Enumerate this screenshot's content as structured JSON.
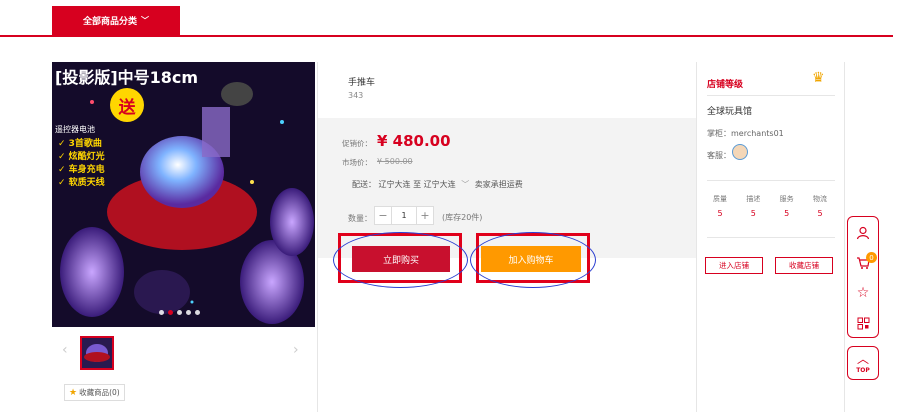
{
  "header": {
    "category_button": "全部商品分类"
  },
  "product": {
    "title": "手推车",
    "code": "343",
    "promo_price_label": "促销价：",
    "promo_price": "¥ 480.00",
    "market_price_label": "市场价：",
    "market_price": "¥ 500.00",
    "shipping": {
      "label": "配送：",
      "from": "辽宁大连",
      "to_prefix": "至",
      "to": "辽宁大连",
      "note": "卖家承担运费"
    },
    "quantity_label": "数量：",
    "quantity": "1",
    "stock": "(库存20件)",
    "buy_now": "立即购买",
    "add_to_cart": "加入购物车"
  },
  "gallery": {
    "image_title": "[投影版]中号18cm",
    "giveaway": "送",
    "remote_battery": "遥控器电池",
    "features": [
      "✓ 3首歌曲",
      "✓ 炫酷灯光",
      "✓ 车身充电",
      "✓ 软质天线"
    ],
    "slide_count": 5,
    "active_slide": 1,
    "prev_arrow": "‹",
    "next_arrow": "›",
    "favorite_goods": "收藏商品(0)"
  },
  "shop": {
    "level_label": "店铺等级",
    "name": "全球玩具馆",
    "merchant": "掌柜：merchants01",
    "service_label": "客服：",
    "scores": [
      {
        "label": "质量",
        "value": "5"
      },
      {
        "label": "描述",
        "value": "5"
      },
      {
        "label": "服务",
        "value": "5"
      },
      {
        "label": "物流",
        "value": "5"
      }
    ],
    "enter_shop": "进入店铺",
    "favorite_shop": "收藏店铺"
  },
  "sidebar": {
    "cart_count": "0",
    "top_label": "TOP"
  },
  "colors": {
    "brand_red": "#d7001f",
    "cart_orange": "#ff9900"
  }
}
